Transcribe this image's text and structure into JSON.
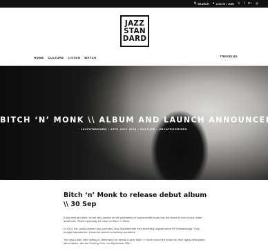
{
  "topbar": {
    "search": "SEARCH",
    "login": "LOG IN / JOIN",
    "social_icons": [
      "twitter-icon",
      "facebook-icon",
      "googleplus-icon",
      "instagram-icon"
    ]
  },
  "logo": {
    "line1": "JAZZ",
    "line2": "STAN",
    "line3": "DARD"
  },
  "nav": {
    "items": [
      "HOME",
      "CULTURE",
      "LISTEN",
      "WATCH"
    ],
    "trending": "TRENDING"
  },
  "hero": {
    "title": "BITCH ‘N’ MONK \\\\ ALBUM AND LAUNCH ANNOUNCED",
    "meta": "JAZZSTANDARD • 13TH JULY 2018 • CULTURE • UNCATEGORISED"
  },
  "article": {
    "heading": "Bitch ‘n’ Monk to release debut album \\\\ 30 Sep",
    "paragraphs": [
      "Every now and then, an act who dances on the perimeters of experimental music has the charm to lure in new, wider audiences. That’s especially the case for Bitch ‘n’ Monk.",
      "In 2014, the London-based duo contorted Jazz Standard with their fearlessly original debut EP Pulsatraunga. They brought sandwiches. It was the start of something wonderful.",
      "Two years later, after writing in hibernation for almost a year, Bitch ‘n’ Monk reveal the teaser for their highly anticipated debut album, We Are Peering Over, out September 30th."
    ]
  }
}
